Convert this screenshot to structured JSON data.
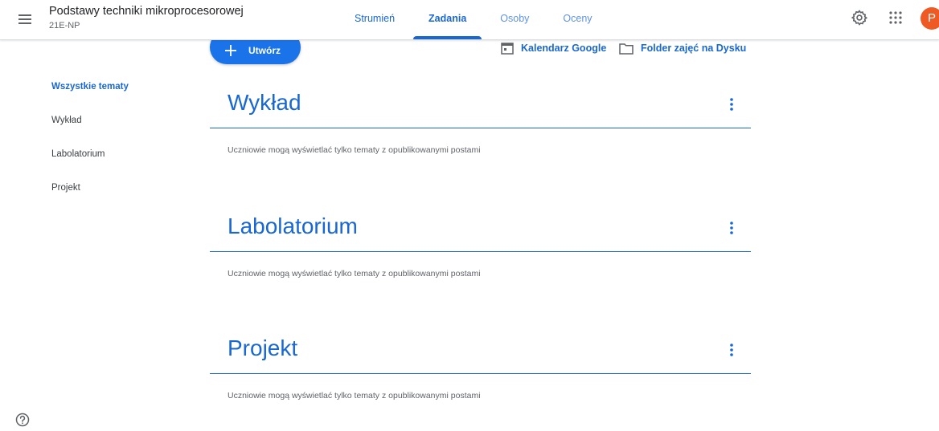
{
  "header": {
    "class_name": "Podstawy techniki mikroprocesorowej",
    "class_section": "21E-NP",
    "avatar_letter": "P",
    "avatar_color": "#ef5a24"
  },
  "tabs": [
    {
      "label": "Strumień",
      "active": false
    },
    {
      "label": "Zadania",
      "active": true
    },
    {
      "label": "Osoby",
      "active": false
    },
    {
      "label": "Oceny",
      "active": false
    }
  ],
  "toolbar": {
    "create_label": "Utwórz",
    "calendar_label": "Kalendarz Google",
    "drive_label": "Folder zajęć na Dysku"
  },
  "sidebar": {
    "items": [
      {
        "label": "Wszystkie tematy",
        "active": true
      },
      {
        "label": "Wykład",
        "active": false
      },
      {
        "label": "Labolatorium",
        "active": false
      },
      {
        "label": "Projekt",
        "active": false
      }
    ]
  },
  "topics": [
    {
      "title": "Wykład",
      "note": "Uczniowie mogą wyświetlać tylko tematy z opublikowanymi postami"
    },
    {
      "title": "Labolatorium",
      "note": "Uczniowie mogą wyświetlać tylko tematy z opublikowanymi postami"
    },
    {
      "title": "Projekt",
      "note": "Uczniowie mogą wyświetlać tylko tematy z opublikowanymi postami"
    }
  ],
  "icons": {
    "menu": "hamburger-menu-icon",
    "settings": "gear-icon",
    "apps": "apps-grid-icon",
    "create": "plus-icon",
    "calendar": "calendar-icon",
    "folder": "folder-icon",
    "more": "more-vert-icon",
    "help": "help-icon"
  },
  "colors": {
    "accent": "#1967d2",
    "primary_button": "#1a73e8"
  }
}
